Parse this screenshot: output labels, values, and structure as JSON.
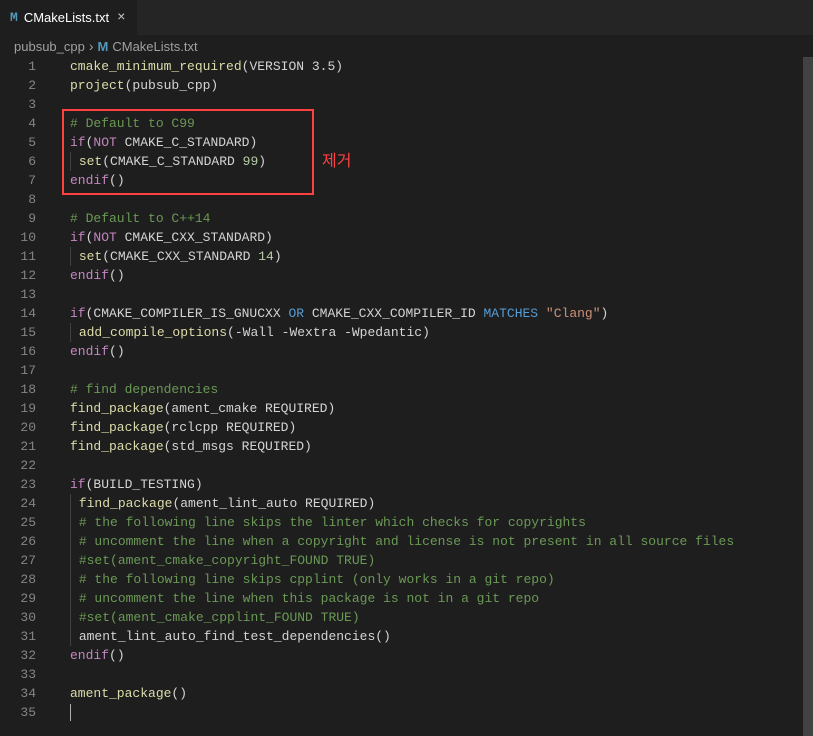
{
  "tab": {
    "icon": "M",
    "label": "CMakeLists.txt",
    "close": "×"
  },
  "breadcrumbs": {
    "item1": "pubsub_cpp",
    "sep": "›",
    "icon2": "M",
    "item2": "CMakeLists.txt"
  },
  "annotation": "제거",
  "lines": [
    1,
    2,
    3,
    4,
    5,
    6,
    7,
    8,
    9,
    10,
    11,
    12,
    13,
    14,
    15,
    16,
    17,
    18,
    19,
    20,
    21,
    22,
    23,
    24,
    25,
    26,
    27,
    28,
    29,
    30,
    31,
    32,
    33,
    34,
    35
  ],
  "code": {
    "l1": {
      "a": "cmake_minimum_required",
      "b": "(",
      "c": "VERSION 3.5",
      "d": ")"
    },
    "l2": {
      "a": "project",
      "b": "(pubsub_cpp)"
    },
    "l4": {
      "a": "# Default to C99"
    },
    "l5": {
      "a": "if",
      "b": "(",
      "c": "NOT",
      "d": " CMAKE_C_STANDARD)"
    },
    "l6": {
      "a": "set",
      "b": "(CMAKE_C_STANDARD ",
      "c": "99",
      "d": ")"
    },
    "l7": {
      "a": "endif",
      "b": "()"
    },
    "l9": {
      "a": "# Default to C++14"
    },
    "l10": {
      "a": "if",
      "b": "(",
      "c": "NOT",
      "d": " CMAKE_CXX_STANDARD)"
    },
    "l11": {
      "a": "set",
      "b": "(CMAKE_CXX_STANDARD ",
      "c": "14",
      "d": ")"
    },
    "l12": {
      "a": "endif",
      "b": "()"
    },
    "l14": {
      "a": "if",
      "b": "(CMAKE_COMPILER_IS_GNUCXX ",
      "c": "OR",
      "d": " CMAKE_CXX_COMPILER_ID ",
      "e": "MATCHES",
      "f": " ",
      "g": "\"Clang\"",
      "h": ")"
    },
    "l15": {
      "a": "add_compile_options",
      "b": "(-Wall -Wextra -Wpedantic)"
    },
    "l16": {
      "a": "endif",
      "b": "()"
    },
    "l18": {
      "a": "# find dependencies"
    },
    "l19": {
      "a": "find_package",
      "b": "(ament_cmake REQUIRED)"
    },
    "l20": {
      "a": "find_package",
      "b": "(rclcpp REQUIRED)"
    },
    "l21": {
      "a": "find_package",
      "b": "(std_msgs REQUIRED)"
    },
    "l23": {
      "a": "if",
      "b": "(BUILD_TESTING)"
    },
    "l24": {
      "a": "find_package",
      "b": "(ament_lint_auto REQUIRED)"
    },
    "l25": {
      "a": "# the following line skips the linter which checks for copyrights"
    },
    "l26": {
      "a": "# uncomment the line when a copyright and license is not present in all source files"
    },
    "l27": {
      "a": "#set(ament_cmake_copyright_FOUND TRUE)"
    },
    "l28": {
      "a": "# the following line skips cpplint (only works in a git repo)"
    },
    "l29": {
      "a": "# uncomment the line when this package is not in a git repo"
    },
    "l30": {
      "a": "#set(ament_cmake_cpplint_FOUND TRUE)"
    },
    "l31": {
      "a": "ament_lint_auto_find_test_dependencies()"
    },
    "l32": {
      "a": "endif",
      "b": "()"
    },
    "l34": {
      "a": "ament_package",
      "b": "()"
    }
  }
}
